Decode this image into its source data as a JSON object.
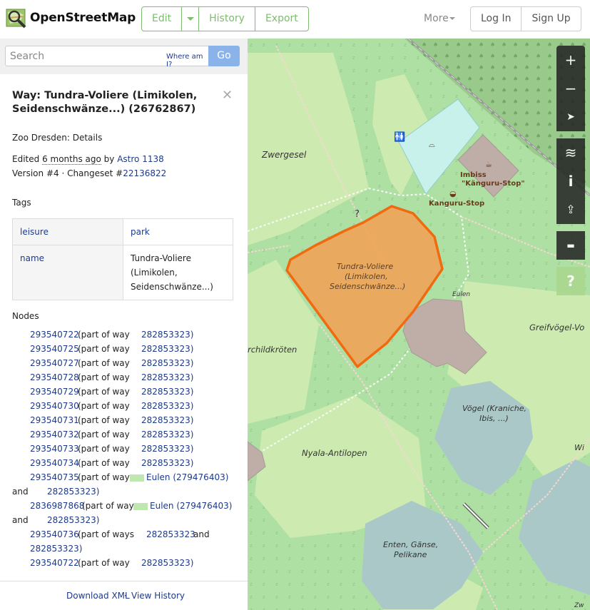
{
  "header": {
    "brand": "OpenStreetMap",
    "edit": "Edit",
    "history": "History",
    "export": "Export",
    "more": "More",
    "login": "Log In",
    "signup": "Sign Up"
  },
  "search": {
    "placeholder": "Search",
    "where": "Where am I?",
    "go": "Go"
  },
  "details": {
    "title": "Way: Tundra-Voliere (Limikolen, Seidenschwänze...) (26762867)",
    "subtitle": "Zoo Dresden: Details",
    "edited_prefix": "Edited ",
    "edited_time": "6 months ago",
    "edited_by": " by ",
    "editor": "Astro 1138",
    "version_prefix": "Version #4 · Changeset #",
    "changeset": "22136822",
    "tags_heading": "Tags",
    "tags": [
      {
        "key": "leisure",
        "value": "park"
      },
      {
        "key": "name",
        "value": "Tundra-Voliere (Limikolen, Seidenschwänze...)"
      }
    ],
    "nodes_heading": "Nodes",
    "part_of_way": "(part of way",
    "part_of_ways": "(part of ways",
    "and": "and",
    "nodes": [
      {
        "id": "293540722",
        "way": "282853323)"
      },
      {
        "id": "293540725",
        "way": "282853323)"
      },
      {
        "id": "293540727",
        "way": "282853323)"
      },
      {
        "id": "293540728",
        "way": "282853323)"
      },
      {
        "id": "293540729",
        "way": "282853323)"
      },
      {
        "id": "293540730",
        "way": "282853323)"
      },
      {
        "id": "293540731",
        "way": "282853323)"
      },
      {
        "id": "293540732",
        "way": "282853323)"
      },
      {
        "id": "293540733",
        "way": "282853323)"
      },
      {
        "id": "293540734",
        "way": "282853323)"
      }
    ],
    "node_multi_1": {
      "id": "293540735",
      "way1": "Eulen (279476403)",
      "way2": "282853323)"
    },
    "node_multi_2": {
      "id": "2836987868",
      "way1": "Eulen (279476403)",
      "way2": "282853323)"
    },
    "node_multi_3": {
      "id": "293540736",
      "way1": "282853323",
      "way2": "282853323)"
    },
    "node_last": {
      "id": "293540722",
      "way": "282853323)"
    }
  },
  "footer": {
    "download": "Download XML",
    "sep": " · ",
    "history": "View History"
  },
  "map": {
    "labels": {
      "zwergesel": "Zwergesel",
      "imbiss": "Imbiss",
      "imbiss_name": "\"Känguru-Stop\"",
      "kanguru": "Kanguru-Stop",
      "tundra1": "Tundra-Voliere",
      "tundra2": "(Limikolen,",
      "tundra3": "Seidenschwänze...)",
      "eulen": "Eulen",
      "greif": "Greifvögel-Vo",
      "schild": "rchildkröten",
      "voegel1": "Vögel (Kraniche,",
      "voegel2": "Ibis, ...)",
      "nyala": "Nyala-Antilopen",
      "enten1": "Enten, Gänse,",
      "enten2": "Pelikane",
      "wi": "Wi",
      "zw": "Zw"
    },
    "controls": {
      "zoom_in": "+",
      "zoom_out": "−",
      "locate": "➤",
      "layers": "≋",
      "info": "i",
      "share": "⇪",
      "note": "▬",
      "help": "?"
    },
    "colors": {
      "park": "#cdebb0",
      "zoo_green": "#aedfa3",
      "highlight_fill": "#f0a458",
      "highlight_stroke": "#f06a10",
      "water": "#aad3df",
      "building": "#bfaea7"
    }
  }
}
